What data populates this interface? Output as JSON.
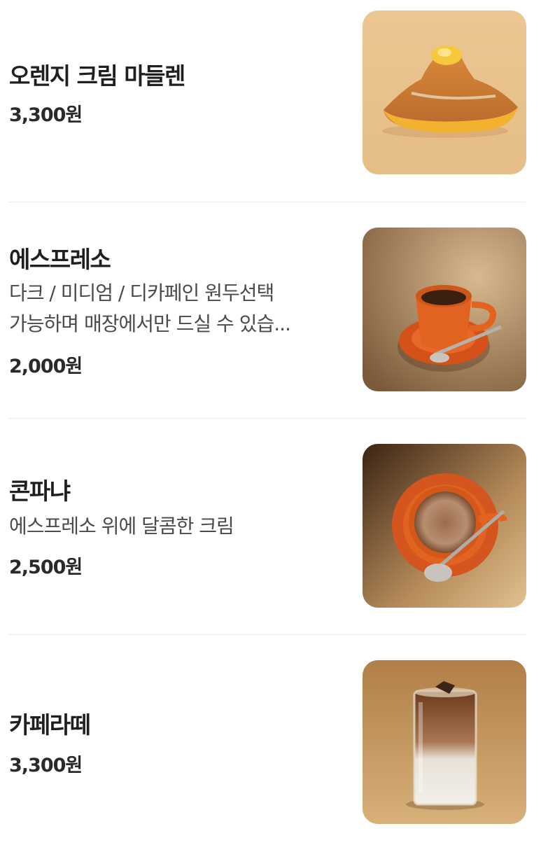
{
  "menu": {
    "items": [
      {
        "name": "오렌지 크림 마들렌",
        "description_lines": [],
        "price": "3,300원",
        "image": "orange-madeleine"
      },
      {
        "name": "에스프레소",
        "description_lines": [
          "다크 / 미디엄 / 디카페인 원두선택",
          "가능하며 매장에서만 드실 수 있습..."
        ],
        "price": "2,000원",
        "image": "espresso-cup"
      },
      {
        "name": "콘파냐",
        "description_lines": [
          "에스프레소 위에 달콤한 크림"
        ],
        "price": "2,500원",
        "image": "con-panna-cup"
      },
      {
        "name": "카페라떼",
        "description_lines": [],
        "price": "3,300원",
        "image": "iced-latte-glass"
      }
    ]
  },
  "colors": {
    "background": "#ffffff",
    "divider": "#ececec",
    "text_primary": "#1f1f1f",
    "text_secondary": "#4a4a4a",
    "accent_orange": "#e2621f"
  }
}
